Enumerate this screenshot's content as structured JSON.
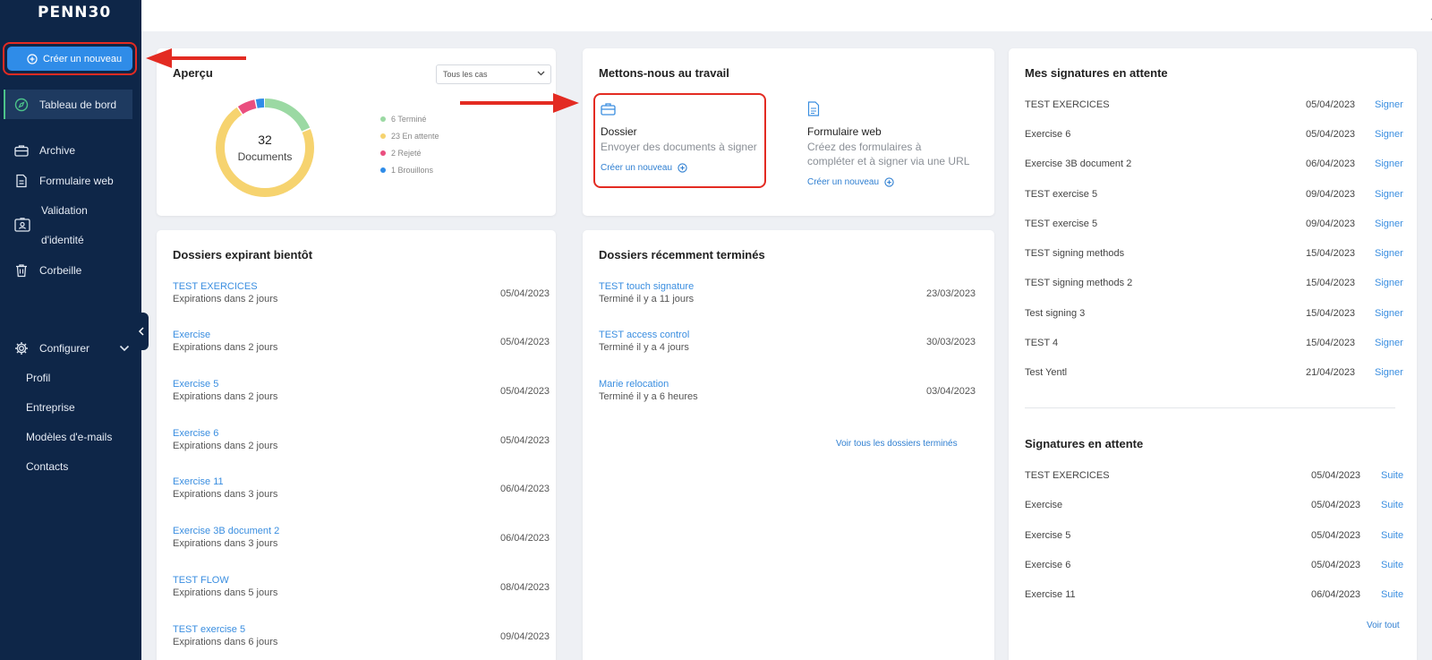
{
  "app": {
    "logo": "PENN30"
  },
  "sidebar": {
    "create_label": "Créer un nouveau",
    "dashboard_label": "Tableau de bord",
    "items": [
      {
        "label": "Archive",
        "icon": "briefcase-icon"
      },
      {
        "label": "Formulaire web",
        "icon": "document-icon"
      },
      {
        "label_line1": "Validation",
        "label_line2": "d'identité",
        "icon": "id-card-icon"
      },
      {
        "label": "Corbeille",
        "icon": "trash-icon"
      }
    ],
    "configure_label": "Configurer",
    "sub_items": [
      "Profil",
      "Entreprise",
      "Modèles d'e-mails",
      "Contacts"
    ]
  },
  "overview": {
    "title": "Aperçu",
    "filter_value": "Tous les cas",
    "total": "32",
    "total_label": "Documents",
    "legend": [
      {
        "label": "6 Terminé",
        "value": 6,
        "color": "#9bd9a3"
      },
      {
        "label": "23 En attente",
        "value": 23,
        "color": "#f6d36f"
      },
      {
        "label": "2 Rejeté",
        "value": 2,
        "color": "#ea4f7f"
      },
      {
        "label": "1 Brouillons",
        "value": 1,
        "color": "#2f8ce8"
      }
    ]
  },
  "get_to_work": {
    "title": "Mettons-nous au travail",
    "dossier": {
      "title": "Dossier",
      "desc": "Envoyer des documents à signer",
      "link": "Créer un nouveau"
    },
    "webform": {
      "title": "Formulaire web",
      "desc_line1": "Créez des formulaires à",
      "desc_line2": "compléter et à signer via une URL",
      "link": "Créer un nouveau"
    }
  },
  "expiring": {
    "title": "Dossiers expirant bientôt",
    "rows": [
      {
        "name": "TEST EXERCICES",
        "sub": "Expirations dans 2 jours",
        "date": "05/04/2023"
      },
      {
        "name": "Exercise",
        "sub": "Expirations dans 2 jours",
        "date": "05/04/2023"
      },
      {
        "name": "Exercise 5",
        "sub": "Expirations dans 2 jours",
        "date": "05/04/2023"
      },
      {
        "name": "Exercise 6",
        "sub": "Expirations dans 2 jours",
        "date": "05/04/2023"
      },
      {
        "name": "Exercise 11",
        "sub": "Expirations dans 3 jours",
        "date": "06/04/2023"
      },
      {
        "name": "Exercise 3B document 2",
        "sub": "Expirations dans 3 jours",
        "date": "06/04/2023"
      },
      {
        "name": "TEST FLOW",
        "sub": "Expirations dans 5 jours",
        "date": "08/04/2023"
      },
      {
        "name": "TEST exercise 5",
        "sub": "Expirations dans 6 jours",
        "date": "09/04/2023"
      }
    ]
  },
  "recent": {
    "title": "Dossiers récemment terminés",
    "rows": [
      {
        "name": "TEST touch signature",
        "sub": "Terminé il y a 11 jours",
        "date": "23/03/2023"
      },
      {
        "name": "TEST access control",
        "sub": "Terminé il y a 4 jours",
        "date": "30/03/2023"
      },
      {
        "name": "Marie relocation",
        "sub": "Terminé il y a 6 heures",
        "date": "03/04/2023"
      }
    ],
    "view_all": "Voir tous les dossiers terminés"
  },
  "my_signatures": {
    "title": "Mes signatures en attente",
    "rows": [
      {
        "name": "TEST EXERCICES",
        "date": "05/04/2023",
        "action": "Signer"
      },
      {
        "name": "Exercise 6",
        "date": "05/04/2023",
        "action": "Signer"
      },
      {
        "name": "Exercise 3B document 2",
        "date": "06/04/2023",
        "action": "Signer"
      },
      {
        "name": "TEST exercise 5",
        "date": "09/04/2023",
        "action": "Signer"
      },
      {
        "name": "TEST exercise 5",
        "date": "09/04/2023",
        "action": "Signer"
      },
      {
        "name": "TEST signing methods",
        "date": "15/04/2023",
        "action": "Signer"
      },
      {
        "name": "TEST signing methods 2",
        "date": "15/04/2023",
        "action": "Signer"
      },
      {
        "name": "Test signing 3",
        "date": "15/04/2023",
        "action": "Signer"
      },
      {
        "name": "TEST 4",
        "date": "15/04/2023",
        "action": "Signer"
      },
      {
        "name": "Test Yentl",
        "date": "21/04/2023",
        "action": "Signer"
      }
    ]
  },
  "pending_signatures": {
    "title": "Signatures en attente",
    "rows": [
      {
        "name": "TEST EXERCICES",
        "date": "05/04/2023",
        "action": "Suite"
      },
      {
        "name": "Exercise",
        "date": "05/04/2023",
        "action": "Suite"
      },
      {
        "name": "Exercise 5",
        "date": "05/04/2023",
        "action": "Suite"
      },
      {
        "name": "Exercise 6",
        "date": "05/04/2023",
        "action": "Suite"
      },
      {
        "name": "Exercise 11",
        "date": "06/04/2023",
        "action": "Suite"
      }
    ],
    "view_all": "Voir tout"
  }
}
